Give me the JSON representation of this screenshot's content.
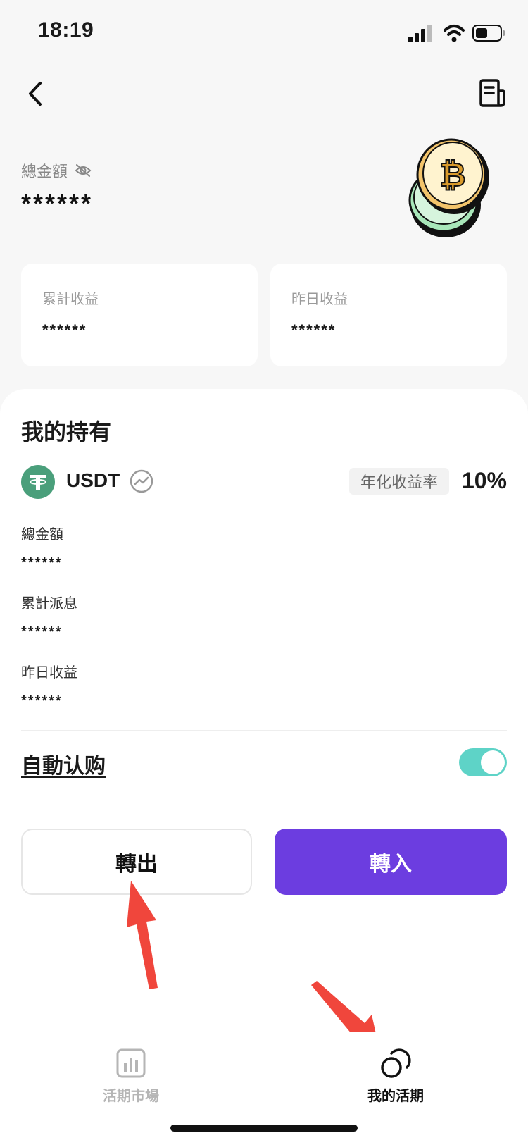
{
  "status_bar": {
    "time": "18:19"
  },
  "summary": {
    "total_label": "總金額",
    "total_value": "******",
    "cumulative_label": "累計收益",
    "cumulative_value": "******",
    "yesterday_label": "昨日收益",
    "yesterday_value": "******"
  },
  "holdings": {
    "title": "我的持有",
    "token": "USDT",
    "apr_label": "年化收益率",
    "apr_value": "10%",
    "details": [
      {
        "label": "總金額",
        "value": "******"
      },
      {
        "label": "累計派息",
        "value": "******"
      },
      {
        "label": "昨日收益",
        "value": "******"
      }
    ],
    "auto_subscribe_label": "自動认购",
    "auto_subscribe_on": true
  },
  "actions": {
    "transfer_out": "轉出",
    "transfer_in": "轉入"
  },
  "nav": {
    "market_label": "活期市場",
    "mine_label": "我的活期"
  },
  "colors": {
    "accent": "#6c3de0",
    "toggle_on": "#5ed3c7",
    "usdt_green": "#4a9f7b",
    "annotation_arrow": "#f0463c"
  }
}
